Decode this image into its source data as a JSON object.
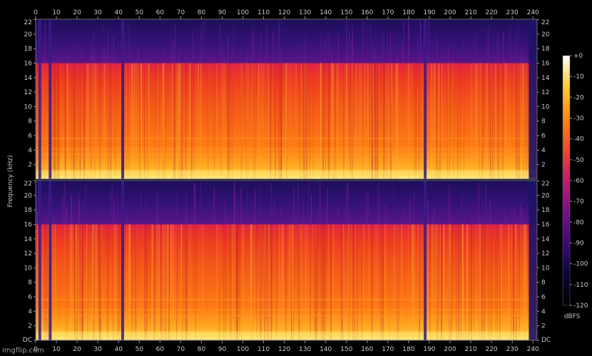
{
  "chart_data": {
    "type": "heatmap",
    "title": "",
    "xlabel": "",
    "ylabel": "Frequency (kHz)",
    "x_ticks": [
      0,
      10,
      20,
      30,
      40,
      50,
      60,
      70,
      80,
      90,
      100,
      110,
      120,
      130,
      140,
      150,
      160,
      170,
      180,
      190,
      200,
      210,
      220,
      230,
      240
    ],
    "xlim": [
      0,
      242
    ],
    "channels": [
      {
        "name": "",
        "y_ticks": [
          "2",
          "4",
          "6",
          "8",
          "10",
          "12",
          "14",
          "16",
          "18",
          "20",
          "22"
        ],
        "ylim": [
          0,
          22.05
        ]
      },
      {
        "name": "",
        "y_ticks": [
          "DC",
          "2",
          "4",
          "6",
          "8",
          "10",
          "12",
          "14",
          "16",
          "18",
          "20",
          "22"
        ],
        "ylim": [
          0,
          22.05
        ]
      }
    ],
    "lowpass_cutoff_khz": 16,
    "dropouts_s": [
      2,
      7,
      42,
      188,
      238
    ],
    "colorbar": {
      "label": "dBFS",
      "ticks": [
        "+0",
        "-10",
        "-20",
        "-30",
        "-40",
        "-50",
        "-60",
        "-70",
        "-80",
        "-90",
        "-100",
        "-110",
        "-120"
      ],
      "range": [
        -120,
        0
      ],
      "colors": [
        "#000000",
        "#0a0638",
        "#3b0a78",
        "#7a0f8c",
        "#c21d6e",
        "#ef4a2a",
        "#ff8a12",
        "#ffc933",
        "#ffffff"
      ]
    }
  },
  "watermark": "imgflip.com"
}
